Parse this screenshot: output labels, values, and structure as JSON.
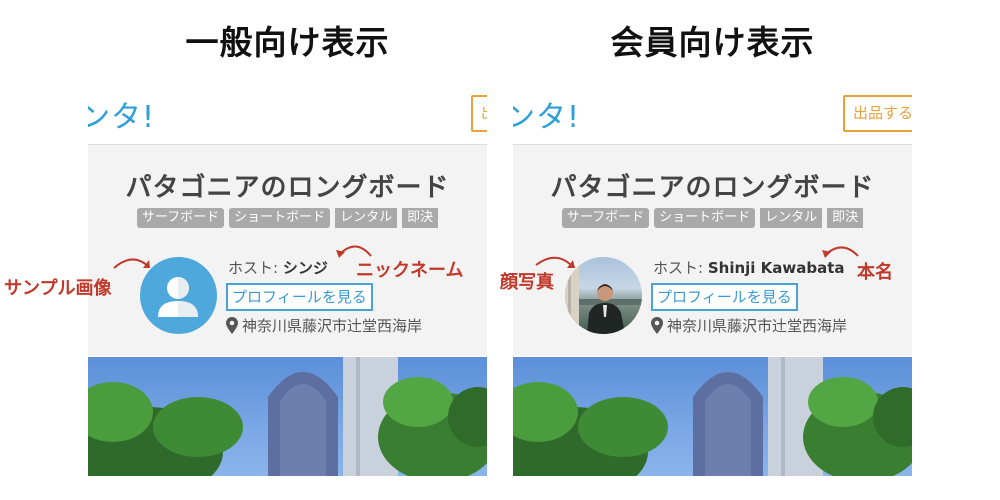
{
  "headings": {
    "general": "一般向け表示",
    "member": "会員向け表示"
  },
  "panels": {
    "general": {
      "brand": "ンタ!",
      "list_button": "出",
      "title": "パタゴニアのロングボード",
      "tags": [
        "サーフボード",
        "ショートボード",
        "レンタル",
        "即決"
      ],
      "host_label": "ホスト:",
      "host_name": "シンジ",
      "profile_button": "プロフィールを見る",
      "location": "神奈川県藤沢市辻堂西海岸",
      "avatar_type": "default-user-icon"
    },
    "member": {
      "brand": "ンタ!",
      "list_button": "出品する",
      "title": "パタゴニアのロングボード",
      "tags": [
        "サーフボード",
        "ショートボード",
        "レンタル",
        "即決"
      ],
      "host_label": "ホスト:",
      "host_name": "Shinji Kawabata",
      "profile_button": "プロフィールを見る",
      "location": "神奈川県藤沢市辻堂西海岸",
      "avatar_type": "face-photo"
    }
  },
  "annotations": {
    "sample_image": "サンプル画像",
    "nickname": "ニックネーム",
    "face_photo": "顔写真",
    "real_name": "本名"
  },
  "colors": {
    "brand": "#2d9fd9",
    "list_button": "#e8a23a",
    "annotation": "#c0392b",
    "tag": "#a9a9a9",
    "profile_button": "#4aa3d7"
  },
  "icons": [
    "user-silhouette-icon",
    "location-pin-icon",
    "curved-arrow-icon"
  ]
}
